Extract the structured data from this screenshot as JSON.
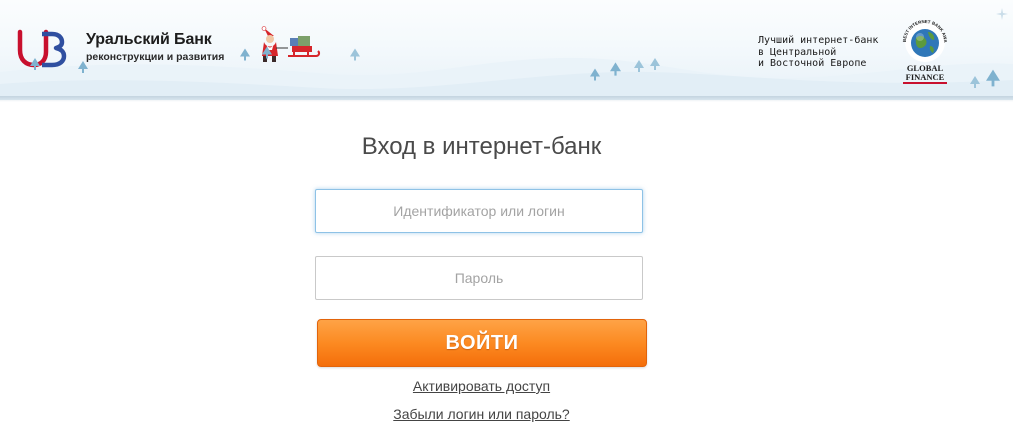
{
  "header": {
    "bank_name": "Уральский Банк",
    "bank_subtitle": "реконструкции и развития",
    "award_lines": [
      "Лучший интернет-банк",
      "в Центральной",
      "и Восточной Европе"
    ],
    "award_logo_text": "GLOBAL FINANCE",
    "award_ring_text": "BEST INTERNET BANK AWARD - 2014"
  },
  "login": {
    "title": "Вход в интернет-банк",
    "login_placeholder": "Идентификатор или логин",
    "login_value": "",
    "password_placeholder": "Пароль",
    "password_value": "",
    "submit_label": "ВОЙТИ",
    "activate_link": "Активировать доступ",
    "forgot_link": "Забыли логин или пароль?"
  },
  "colors": {
    "accent_orange": "#fc8a22",
    "logo_red": "#c8102e",
    "logo_blue": "#2f4fa0",
    "focus_blue": "#8ec2e6",
    "tree_blue": "#7fb2cf"
  },
  "icons": {
    "logo": "ubrd-logo-icon",
    "holiday": "santa-sled-icon",
    "award": "globe-award-icon",
    "decoration": "fir-tree-icon"
  }
}
